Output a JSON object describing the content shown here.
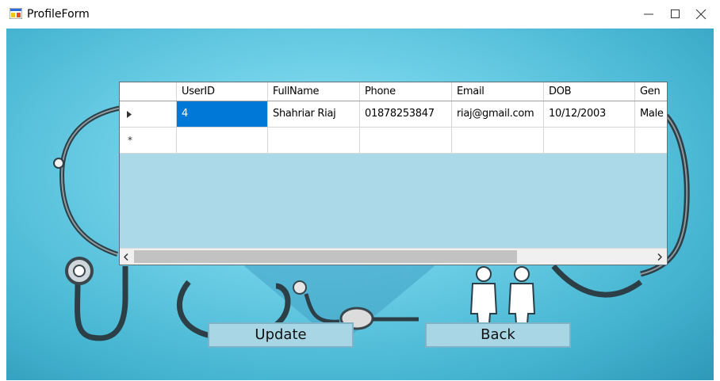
{
  "window": {
    "title": "ProfileForm"
  },
  "grid": {
    "columns": [
      "UserID",
      "FullName",
      "Phone",
      "Email",
      "DOB",
      "Gen"
    ],
    "rows": [
      {
        "userid": "4",
        "fullname": "Shahriar Riaj",
        "phone": "01878253847",
        "email": "riaj@gmail.com",
        "dob": "10/12/2003",
        "gender": "Male"
      }
    ],
    "new_row_marker": "*"
  },
  "buttons": {
    "update": "Update",
    "back": "Back"
  },
  "colors": {
    "selection": "#0078d7",
    "grid_background": "#abd9e8",
    "button_background": "#a8d6e5"
  }
}
